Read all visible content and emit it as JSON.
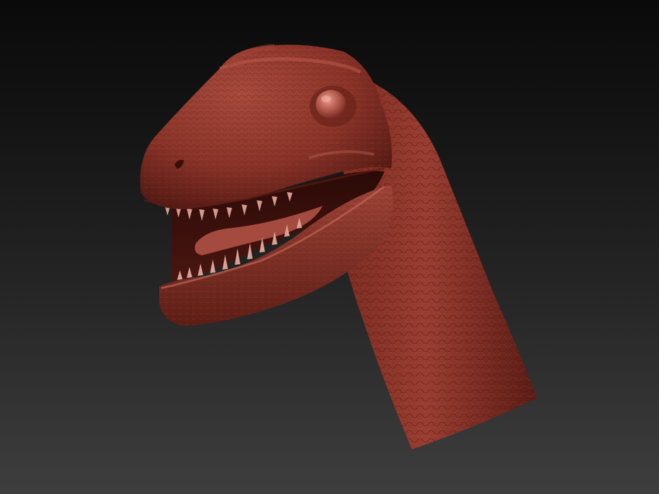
{
  "viewport": {
    "background_top": "#0a0a0a",
    "background_bottom": "#3e3e3e"
  },
  "model": {
    "subject": "dinosaur-head",
    "material_color": "#8a3328",
    "material_highlight": "#b0564a",
    "material_shadow": "#4a1510"
  }
}
